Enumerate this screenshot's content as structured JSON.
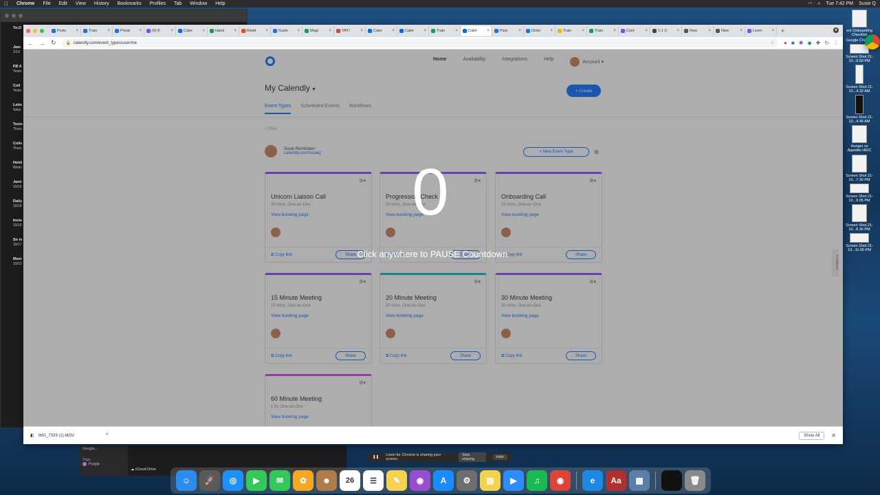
{
  "menubar": {
    "app": "Chrome",
    "items": [
      "File",
      "Edit",
      "View",
      "History",
      "Bookmarks",
      "Profiles",
      "Tab",
      "Window",
      "Help"
    ],
    "clock": "Tue 7:42 PM",
    "user": "Susie Q"
  },
  "bg_window": {
    "items": [
      {
        "title": "To-D",
        "sub": ""
      },
      {
        "title": "Jam",
        "sub": "3:53"
      },
      {
        "title": "FB A",
        "sub": "Yeste"
      },
      {
        "title": "Coll",
        "sub": "Yeste"
      },
      {
        "title": "Lette",
        "sub": "Satur"
      },
      {
        "title": "Teste",
        "sub": "Thurs"
      },
      {
        "title": "Colle",
        "sub": "Thurs"
      },
      {
        "title": "Heidi",
        "sub": "Wedn"
      },
      {
        "title": "Jami",
        "sub": "10/18"
      },
      {
        "title": "Daily",
        "sub": "10/18"
      },
      {
        "title": "Insta",
        "sub": "10/18"
      },
      {
        "title": "So m",
        "sub": "10/17"
      },
      {
        "title": "Meet",
        "sub": "10/13"
      }
    ]
  },
  "desktop_icons": [
    {
      "label": "ent Onboarding Checklist",
      "type": "doc"
    },
    {
      "label": "Google Chrome",
      "type": "chrome"
    },
    {
      "label": "Screen Shot 21-10...9.50 PM",
      "type": "shot"
    },
    {
      "label": "Screen Shot 21-10...4.32 AM",
      "type": "phone"
    },
    {
      "label": "Screen Shot 21-10...4.45 AM",
      "type": "phone-dark"
    },
    {
      "label": "Hunger vs Appetite.HEIC",
      "type": "doc"
    },
    {
      "label": "Screen Shot 21-10...7.30 PM",
      "type": "doc"
    },
    {
      "label": "Screen Shot 21-10...9.05 PM",
      "type": "shot"
    },
    {
      "label": "Screen Shot 21-10...8.36 PM",
      "type": "doc"
    },
    {
      "label": "Screen Shot 21-10...11.05 PM",
      "type": "shot"
    }
  ],
  "tabs": [
    {
      "label": "Portu",
      "color": "#1a73e8"
    },
    {
      "label": "Train",
      "color": "#1a73e8"
    },
    {
      "label": "Privat",
      "color": "#1a73e8"
    },
    {
      "label": "(6) K",
      "color": "#8247f5"
    },
    {
      "label": "Caler",
      "color": "#0069ff"
    },
    {
      "label": "Hand",
      "color": "#0f9d58"
    },
    {
      "label": "Redd",
      "color": "#ff4500"
    },
    {
      "label": "Susie",
      "color": "#1a73e8"
    },
    {
      "label": "Magi",
      "color": "#0f9d58"
    },
    {
      "label": "YAY!",
      "color": "#db4437"
    },
    {
      "label": "Caler",
      "color": "#0069ff"
    },
    {
      "label": "Caler",
      "color": "#0069ff"
    },
    {
      "label": "Train",
      "color": "#0f9d58"
    },
    {
      "label": "Caler",
      "color": "#0069ff",
      "active": true
    },
    {
      "label": "Past",
      "color": "#1a73e8"
    },
    {
      "label": "Onbo",
      "color": "#1a73e8"
    },
    {
      "label": "Train",
      "color": "#f4b400"
    },
    {
      "label": "Train",
      "color": "#0f9d58"
    },
    {
      "label": "Cont",
      "color": "#8247f5"
    },
    {
      "label": "1-1 C",
      "color": "#444"
    },
    {
      "label": "New",
      "color": "#555"
    },
    {
      "label": "New",
      "color": "#555"
    },
    {
      "label": "Loom",
      "color": "#625df5"
    }
  ],
  "address": "calendly.com/event_types/user/me",
  "calendly": {
    "nav": {
      "home": "Home",
      "availability": "Availability",
      "integrations": "Integrations",
      "help": "Help",
      "account": "Account"
    },
    "title": "My Calendly",
    "create": "+ Create",
    "page_tabs": [
      "Event Types",
      "Scheduled Events",
      "Workflows"
    ],
    "filter_placeholder": "Filter",
    "user_name": "Susie Richtholen",
    "user_url": "calendly.com/susieq",
    "new_event": "+ New Event Type",
    "events": [
      {
        "title": "Unicorn Liaison Call",
        "meta": "20 mins, One-on-One",
        "color": "#8247f5"
      },
      {
        "title": "Progression Check",
        "meta": "20 mins, One-on-One",
        "color": "#8247f5"
      },
      {
        "title": "Onboarding Call",
        "meta": "15 mins, One-on-One",
        "color": "#8247f5"
      },
      {
        "title": "15 Minute Meeting",
        "meta": "15 mins, One-on-One",
        "color": "#8247f5"
      },
      {
        "title": "20 Minute Meeting",
        "meta": "20 mins, One-on-One",
        "color": "#0ab6b6"
      },
      {
        "title": "30 Minute Meeting",
        "meta": "30 mins, One-on-One",
        "color": "#8247f5"
      },
      {
        "title": "60 Minute Meeting",
        "meta": "1 hr, One-on-One",
        "color": "#c74ae0"
      }
    ],
    "view_booking": "View booking page",
    "copy_link": "Copy link",
    "share": "Share",
    "feedback": "Feedback"
  },
  "countdown": {
    "value": "0",
    "message": "Click anywhere to PAUSE Countdown"
  },
  "download": {
    "file": "IMG_7329 (1).MOV",
    "show_all": "Show All"
  },
  "finder": {
    "item": "Google...",
    "tags": "Tags",
    "tag": "Purple",
    "icloud": "iCloud Drive"
  },
  "loom_bar": {
    "text": "Loom for Chrome is sharing your screen.",
    "stop": "Stop sharing",
    "hide": "Hide"
  },
  "dock": [
    {
      "name": "finder",
      "color": "#2d8cf0",
      "glyph": "☺"
    },
    {
      "name": "launchpad",
      "color": "#5a5a5a",
      "glyph": "🚀"
    },
    {
      "name": "safari",
      "color": "#1e90ff",
      "glyph": "◎"
    },
    {
      "name": "facetime",
      "color": "#34c759",
      "glyph": "▶"
    },
    {
      "name": "messages",
      "color": "#34c759",
      "glyph": "✉"
    },
    {
      "name": "photos",
      "color": "#f5a623",
      "glyph": "✿"
    },
    {
      "name": "contacts",
      "color": "#b07b4a",
      "glyph": "☻"
    },
    {
      "name": "calendar",
      "color": "#ffffff",
      "glyph": "26"
    },
    {
      "name": "reminders",
      "color": "#ffffff",
      "glyph": "☰"
    },
    {
      "name": "notes",
      "color": "#f7d154",
      "glyph": "✎"
    },
    {
      "name": "podcasts",
      "color": "#9b4dcf",
      "glyph": "◉"
    },
    {
      "name": "app-store",
      "color": "#1a8cff",
      "glyph": "A"
    },
    {
      "name": "system-preferences",
      "color": "#6e6e6e",
      "glyph": "⚙"
    },
    {
      "name": "stickies",
      "color": "#f2d24e",
      "glyph": "▤"
    },
    {
      "name": "zoom",
      "color": "#2d8cff",
      "glyph": "▶"
    },
    {
      "name": "spotify",
      "color": "#1db954",
      "glyph": "♫"
    },
    {
      "name": "chrome",
      "color": "#db4437",
      "glyph": "◉"
    },
    {
      "name": "edge",
      "color": "#1e88e5",
      "glyph": "e"
    },
    {
      "name": "dictionary",
      "color": "#b03030",
      "glyph": "Aa"
    },
    {
      "name": "preview",
      "color": "#5a7fa8",
      "glyph": "▦"
    },
    {
      "name": "minimized-window",
      "color": "#111111",
      "glyph": ""
    },
    {
      "name": "trash",
      "color": "#8a8a8a",
      "glyph": "🗑"
    }
  ]
}
